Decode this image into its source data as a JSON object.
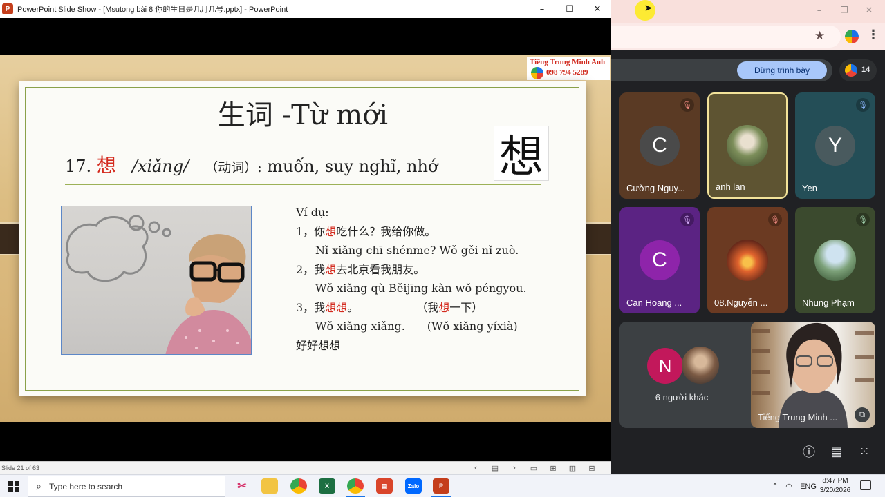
{
  "ppt": {
    "window_title": "PowerPoint Slide Show - [Msutong bài 8 你的生日是几月几号.pptx] - PowerPoint",
    "logo_letter": "P",
    "minimize": "–",
    "maximize": "☐",
    "close": "✕",
    "brand_name": "Tiếng Trung Minh Anh",
    "brand_phone": "098 794 5289",
    "status": "Slide 21 of 63"
  },
  "slide": {
    "title": "生词 -Từ mới",
    "vocab_number": "17.",
    "vocab_char": "想",
    "vocab_pinyin": "/xiǎng/",
    "vocab_pos": "（动词）:",
    "vocab_meaning": "muốn, suy nghĩ, nhớ",
    "big_char": "想",
    "examples_heading": "Ví dụ:",
    "ex1_a": "1，你",
    "ex1_b": "想",
    "ex1_c": "吃什么？我给你做。",
    "ex1_pinyin": "Nǐ xiǎng chī shénme? Wǒ gěi nǐ zuò.",
    "ex2_a": "2，我",
    "ex2_b": "想",
    "ex2_c": "去北京看我朋友。",
    "ex2_pinyin": "Wǒ xiǎng qù Běijīng kàn wǒ péngyou.",
    "ex3_a": "3，我",
    "ex3_b": "想想",
    "ex3_c": "。",
    "ex3_d": "（我",
    "ex3_e": "想",
    "ex3_f": "一下）",
    "ex3_pinyin": "Wǒ xiǎng xiǎng.",
    "ex3_pinyin2": "(Wǒ xiǎng yíxià)",
    "ex4": "好好想想"
  },
  "meet": {
    "present_label": "Dừng trình bày",
    "people_count": "14",
    "tiles": [
      {
        "name": "Cường Nguy...",
        "initial": "C",
        "color": "#5a3a24"
      },
      {
        "name": "anh lan",
        "initial": "",
        "color": "#5e5432"
      },
      {
        "name": "Yen",
        "initial": "Y",
        "color": "#244e57"
      },
      {
        "name": "Can Hoang ...",
        "initial": "C",
        "color": "#5b2383"
      },
      {
        "name": "08.Nguyễn ...",
        "initial": "",
        "color": "#6b3a22"
      },
      {
        "name": "Nhung Phạm",
        "initial": "",
        "color": "#3b4a2e"
      }
    ],
    "others_initial": "N",
    "others_label": "6 người khác",
    "self_label": "Tiếng Trung Minh ...",
    "mute_glyph": "🎙"
  },
  "taskbar": {
    "search_placeholder": "Type here to search",
    "lang": "ENG",
    "time": "8:47 PM",
    "date": "3/20/2026",
    "excel": "X",
    "zalo": "Zalo",
    "ppt": "P"
  },
  "colors": {
    "accent_red": "#d42a1e",
    "present_blue": "#a8c7fa"
  }
}
